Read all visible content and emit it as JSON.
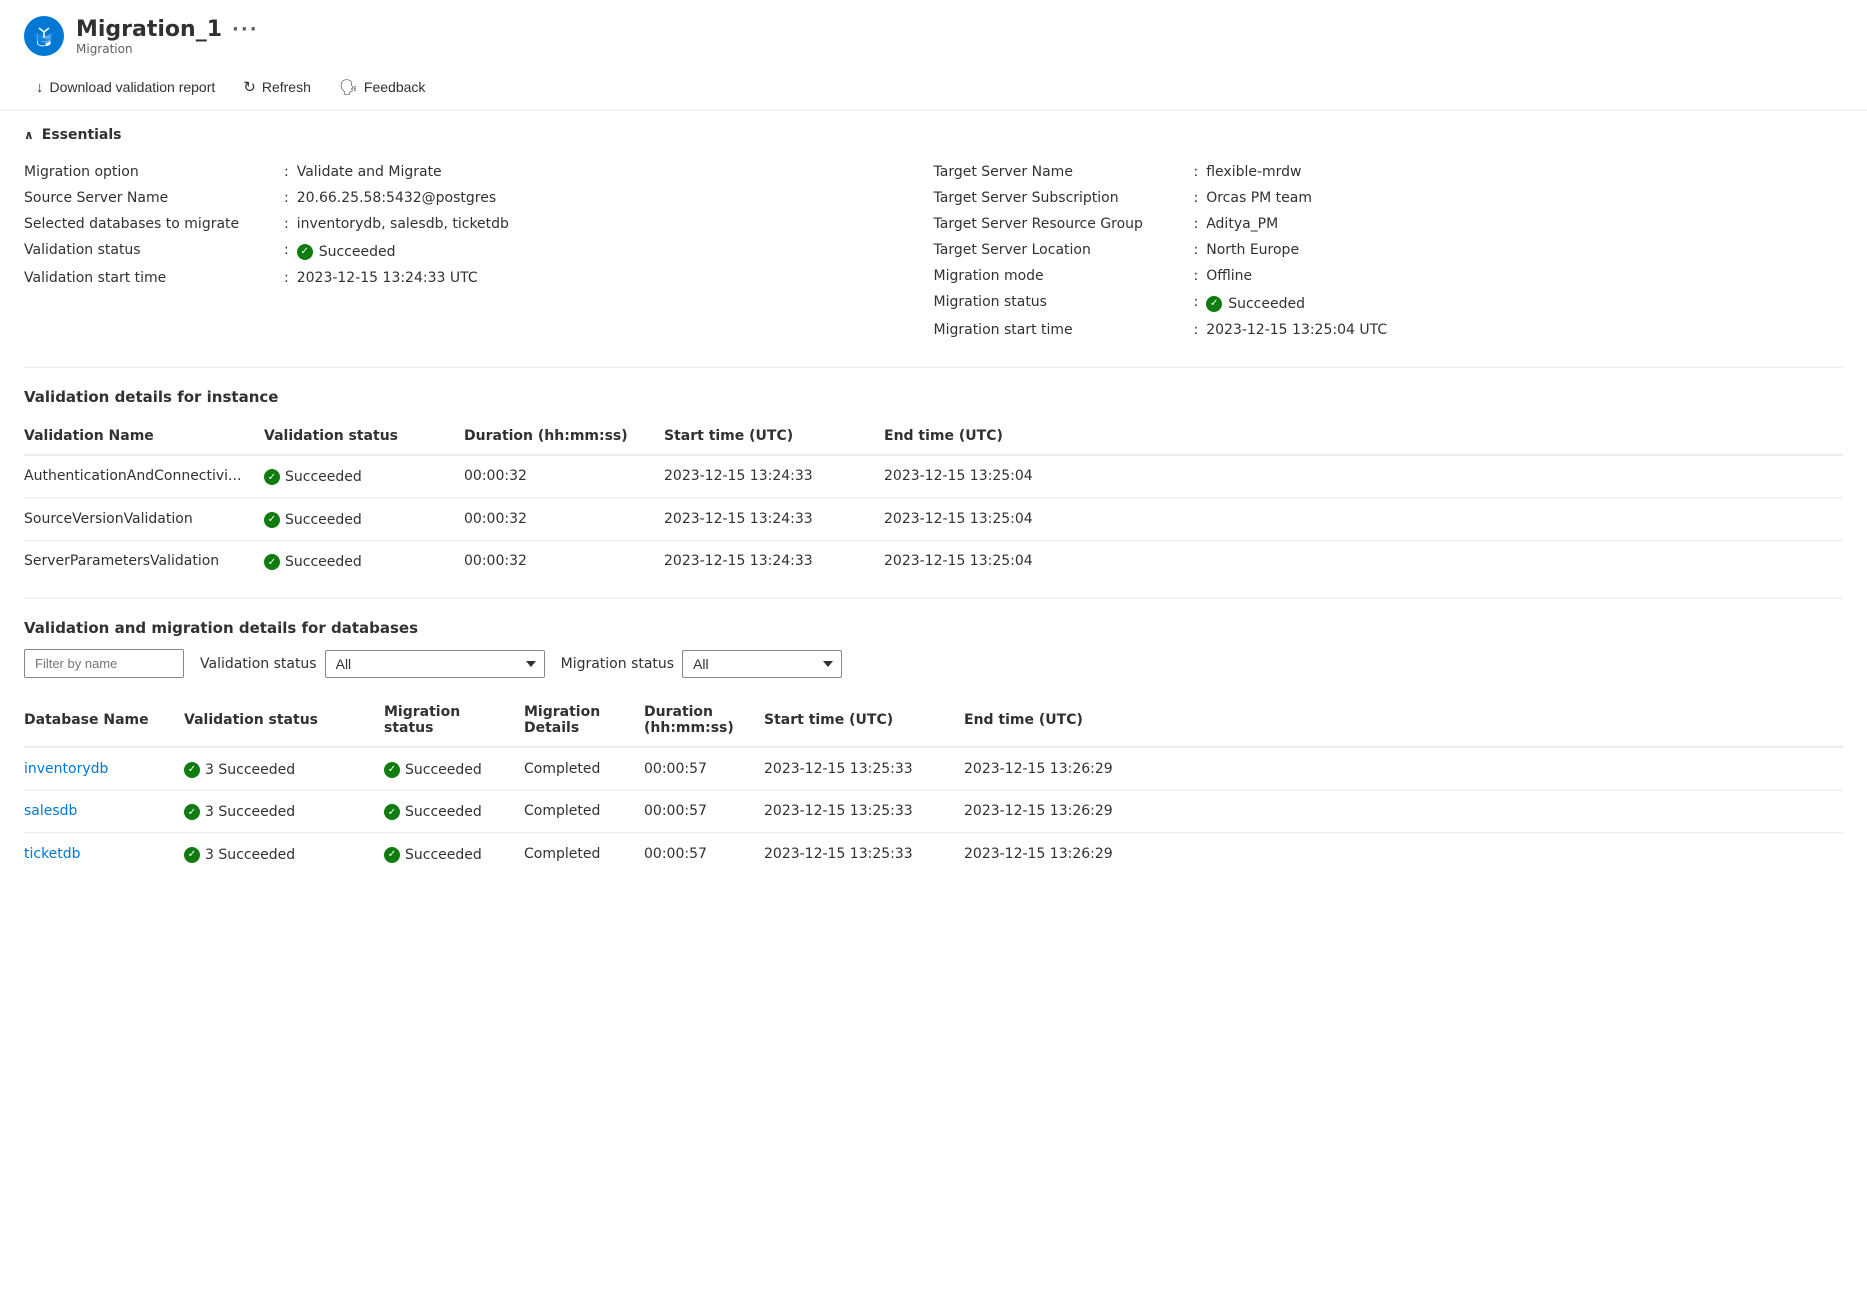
{
  "header": {
    "title": "Migration_1",
    "subtitle": "Migration",
    "more_icon": "···"
  },
  "toolbar": {
    "download_label": "Download validation report",
    "refresh_label": "Refresh",
    "feedback_label": "Feedback"
  },
  "essentials": {
    "section_label": "Essentials",
    "left": [
      {
        "label": "Migration option",
        "value": "Validate and Migrate"
      },
      {
        "label": "Source Server Name",
        "value": "20.66.25.58:5432@postgres"
      },
      {
        "label": "Selected databases to migrate",
        "value": "inventorydb, salesdb, ticketdb"
      },
      {
        "label": "Validation status",
        "value": "Succeeded",
        "icon": true
      },
      {
        "label": "Validation start time",
        "value": "2023-12-15 13:24:33 UTC"
      }
    ],
    "right": [
      {
        "label": "Target Server Name",
        "value": "flexible-mrdw"
      },
      {
        "label": "Target Server Subscription",
        "value": "Orcas PM team"
      },
      {
        "label": "Target Server Resource Group",
        "value": "Aditya_PM"
      },
      {
        "label": "Target Server Location",
        "value": "North Europe"
      },
      {
        "label": "Migration mode",
        "value": "Offline"
      },
      {
        "label": "Migration status",
        "value": "Succeeded",
        "icon": true
      },
      {
        "label": "Migration start time",
        "value": "2023-12-15 13:25:04 UTC"
      }
    ]
  },
  "validation_section": {
    "title": "Validation details for instance",
    "columns": [
      "Validation Name",
      "Validation status",
      "Duration (hh:mm:ss)",
      "Start time (UTC)",
      "End time (UTC)"
    ],
    "rows": [
      {
        "name": "AuthenticationAndConnectivi...",
        "status": "Succeeded",
        "duration": "00:00:32",
        "start": "2023-12-15 13:24:33",
        "end": "2023-12-15 13:25:04"
      },
      {
        "name": "SourceVersionValidation",
        "status": "Succeeded",
        "duration": "00:00:32",
        "start": "2023-12-15 13:24:33",
        "end": "2023-12-15 13:25:04"
      },
      {
        "name": "ServerParametersValidation",
        "status": "Succeeded",
        "duration": "00:00:32",
        "start": "2023-12-15 13:24:33",
        "end": "2023-12-15 13:25:04"
      }
    ]
  },
  "migration_section": {
    "title": "Validation and migration details for databases",
    "filter": {
      "placeholder": "Filter by name",
      "validation_label": "Validation status",
      "validation_value": "All",
      "migration_label": "Migration status",
      "migration_value": "All"
    },
    "columns": [
      "Database Name",
      "Validation status",
      "Migration status",
      "Migration Details",
      "Duration (hh:mm:ss)",
      "Start time (UTC)",
      "End time (UTC)"
    ],
    "rows": [
      {
        "name": "inventorydb",
        "validation_status": "3 Succeeded",
        "migration_status": "Succeeded",
        "migration_details": "Completed",
        "duration": "00:00:57",
        "start": "2023-12-15 13:25:33",
        "end": "2023-12-15 13:26:29"
      },
      {
        "name": "salesdb",
        "validation_status": "3 Succeeded",
        "migration_status": "Succeeded",
        "migration_details": "Completed",
        "duration": "00:00:57",
        "start": "2023-12-15 13:25:33",
        "end": "2023-12-15 13:26:29"
      },
      {
        "name": "ticketdb",
        "validation_status": "3 Succeeded",
        "migration_status": "Succeeded",
        "migration_details": "Completed",
        "duration": "00:00:57",
        "start": "2023-12-15 13:25:33",
        "end": "2023-12-15 13:26:29"
      }
    ]
  }
}
